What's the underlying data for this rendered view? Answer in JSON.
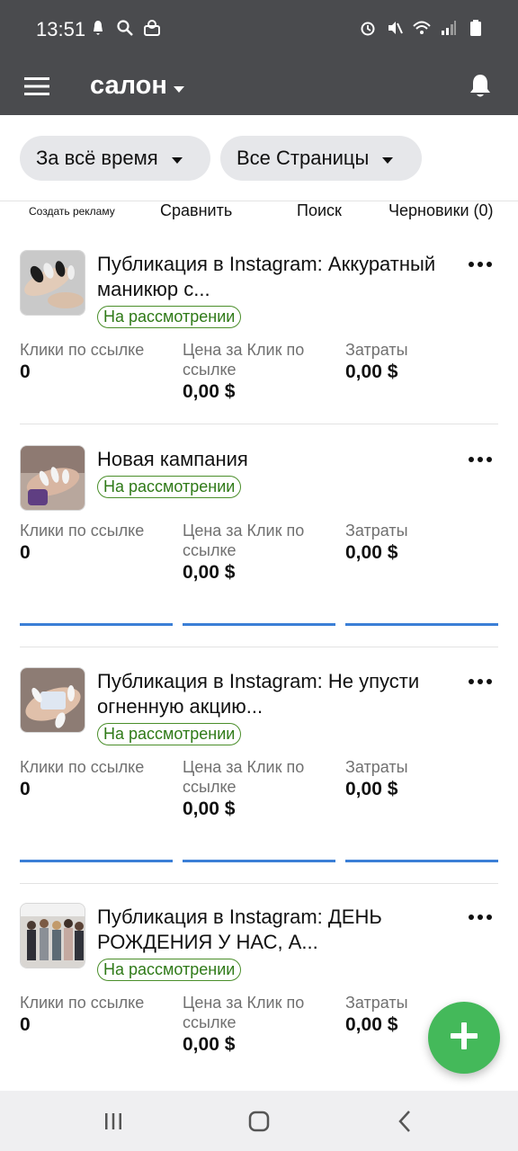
{
  "status_bar": {
    "time": "13:51",
    "left_icons": [
      "notification-icon",
      "search-icon",
      "app-icon"
    ],
    "right_icons": [
      "alarm-icon",
      "mute-icon",
      "wifi-icon",
      "signal-icon",
      "battery-icon"
    ]
  },
  "app_bar": {
    "title": "салон",
    "menu_icon": "hamburger-menu-icon",
    "bell_icon": "bell-icon"
  },
  "filters": {
    "period": "За всё время",
    "pages": "Все Страницы"
  },
  "actions": {
    "create": "Создать рекламу",
    "compare": "Сравнить",
    "search": "Поиск",
    "drafts": "Черновики (0)"
  },
  "metric_labels": {
    "clicks": "Клики по ссылке",
    "cpc": "Цена за Клик по ссылке",
    "spend": "Затраты"
  },
  "cards": [
    {
      "title": "Публикация в Instagram: Аккуратный маникюр с...",
      "status": "На рассмотрении",
      "clicks": "0",
      "cpc": "0,00 $",
      "spend": "0,00 $"
    },
    {
      "title": "Новая кампания",
      "status": "На рассмотрении",
      "clicks": "0",
      "cpc": "0,00 $",
      "spend": "0,00 $"
    },
    {
      "title": "Публикация в Instagram: Не упусти огненную акцию...",
      "status": "На рассмотрении",
      "clicks": "0",
      "cpc": "0,00 $",
      "spend": "0,00 $"
    },
    {
      "title": "Публикация в Instagram: ДЕНЬ РОЖДЕНИЯ У НАС, А...",
      "status": "На рассмотрении",
      "clicks": "0",
      "cpc": "0,00 $",
      "spend": "0,00 $"
    }
  ],
  "colors": {
    "bar": "#4a4b4e",
    "badge": "#2f7a18",
    "fab": "#44b95a",
    "progress": "#3b7fd6"
  },
  "fab_icon": "plus-icon",
  "nav": {
    "recents": "recents-icon",
    "home": "home-icon",
    "back": "back-icon"
  }
}
